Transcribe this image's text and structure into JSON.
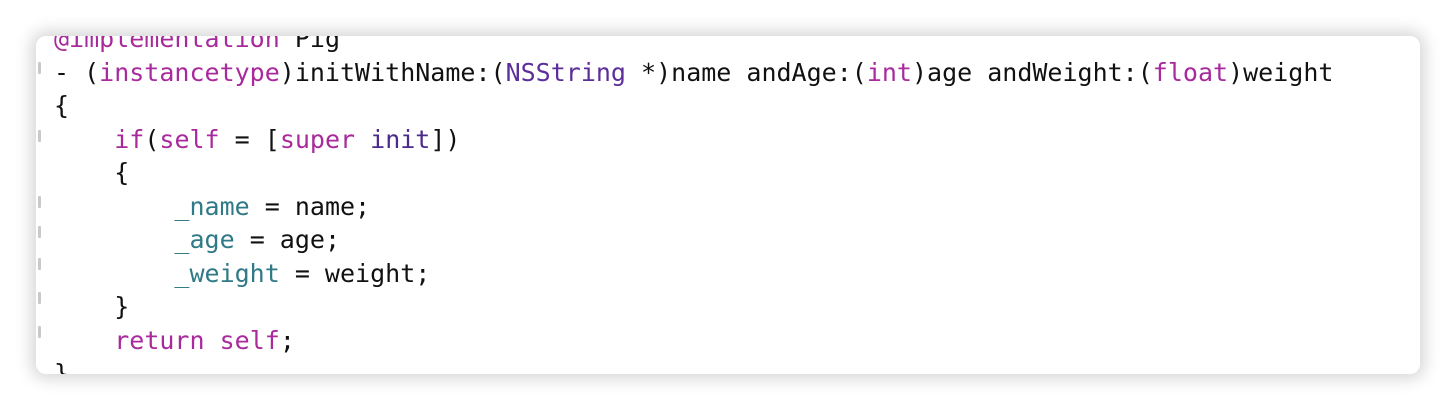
{
  "editor": {
    "colors": {
      "background": "#ffffff",
      "plain": "#111111",
      "keyword": "#a82a9c",
      "type": "#5c2e99",
      "ivar": "#2f7a86",
      "method": "#4a2a8a",
      "directive": "#a82a9c"
    },
    "lines": [
      {
        "indent": "",
        "tokens": [
          {
            "text": "@implementation",
            "kind": "directive"
          },
          {
            "text": " ",
            "kind": "plain"
          },
          {
            "text": "Pig",
            "kind": "plain"
          }
        ]
      },
      {
        "indent": "",
        "tokens": [
          {
            "text": "- (",
            "kind": "plain"
          },
          {
            "text": "instancetype",
            "kind": "keyword"
          },
          {
            "text": ")initWithName:(",
            "kind": "plain"
          },
          {
            "text": "NSString",
            "kind": "type"
          },
          {
            "text": " *)name andAge:(",
            "kind": "plain"
          },
          {
            "text": "int",
            "kind": "keyword"
          },
          {
            "text": ")age andWeight:(",
            "kind": "plain"
          },
          {
            "text": "float",
            "kind": "keyword"
          },
          {
            "text": ")weight",
            "kind": "plain"
          }
        ]
      },
      {
        "indent": "",
        "tokens": [
          {
            "text": "{",
            "kind": "plain"
          }
        ]
      },
      {
        "indent": "    ",
        "tokens": [
          {
            "text": "if",
            "kind": "keyword"
          },
          {
            "text": "(",
            "kind": "plain"
          },
          {
            "text": "self",
            "kind": "keyword"
          },
          {
            "text": " = [",
            "kind": "plain"
          },
          {
            "text": "super",
            "kind": "keyword"
          },
          {
            "text": " ",
            "kind": "plain"
          },
          {
            "text": "init",
            "kind": "method"
          },
          {
            "text": "])",
            "kind": "plain"
          }
        ]
      },
      {
        "indent": "    ",
        "tokens": [
          {
            "text": "{",
            "kind": "plain"
          }
        ]
      },
      {
        "indent": "        ",
        "tokens": [
          {
            "text": "_name",
            "kind": "ivar"
          },
          {
            "text": " = name;",
            "kind": "plain"
          }
        ]
      },
      {
        "indent": "        ",
        "tokens": [
          {
            "text": "_age",
            "kind": "ivar"
          },
          {
            "text": " = age;",
            "kind": "plain"
          }
        ]
      },
      {
        "indent": "        ",
        "tokens": [
          {
            "text": "_weight",
            "kind": "ivar"
          },
          {
            "text": " = weight;",
            "kind": "plain"
          }
        ]
      },
      {
        "indent": "    ",
        "tokens": [
          {
            "text": "}",
            "kind": "plain"
          }
        ]
      },
      {
        "indent": "    ",
        "tokens": [
          {
            "text": "return",
            "kind": "keyword"
          },
          {
            "text": " ",
            "kind": "plain"
          },
          {
            "text": "self",
            "kind": "keyword"
          },
          {
            "text": ";",
            "kind": "plain"
          }
        ]
      },
      {
        "indent": "",
        "tokens": [
          {
            "text": "}",
            "kind": "plain"
          }
        ]
      }
    ]
  }
}
